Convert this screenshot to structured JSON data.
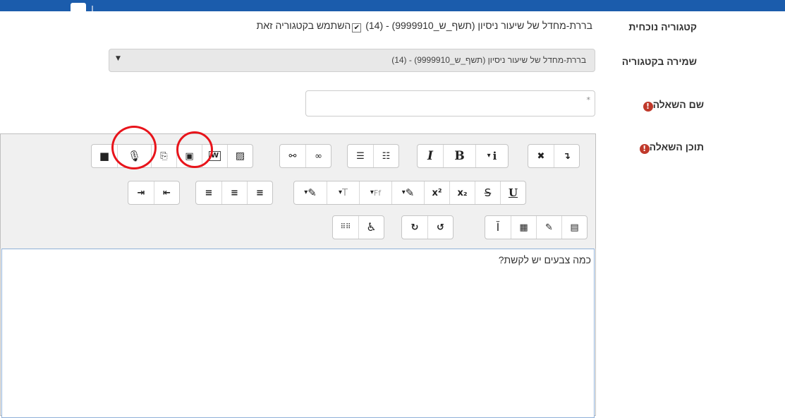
{
  "colors": {
    "topbar": "#1b5cac",
    "required": "#c0392b",
    "annotation": "#e8141b"
  },
  "form": {
    "current_category": {
      "label": "קטגוריה נוכחית",
      "value": "בררת-מחדל של שיעור ניסיון (תשף_ש_9999910) - (14)",
      "checkbox_label": "השתמש בקטגוריה זאת",
      "checked": true
    },
    "save_in_category": {
      "label": "שמירה בקטגוריה",
      "selected": "בררת-מחדל של שיעור ניסיון (תשף_ש_9999910) - (14)"
    },
    "question_name": {
      "label": "שם השאלה",
      "value": "",
      "required_marker": "*"
    },
    "question_text": {
      "label": "תוכן השאלה",
      "content": "כמה צבעים יש לקשת?"
    }
  },
  "toolbar": {
    "row1": [
      [
        "fullscreen-icon",
        "collapse-icon"
      ],
      [
        "text-style-dropdown",
        "bold",
        "italic"
      ],
      [
        "unordered-list-icon",
        "ordered-list-icon"
      ],
      [
        "link-icon",
        "unlink-icon"
      ],
      [
        "image-icon",
        "word-import-icon",
        "video-record-icon",
        "paste-icon",
        "audio-record-icon",
        "video-icon"
      ]
    ],
    "row2": [
      [
        "underline",
        "strikethrough",
        "subscript",
        "superscript",
        "background-color-dropdown"
      ],
      [
        "font-family-dropdown",
        "font-size-dropdown",
        "text-color-dropdown"
      ],
      [
        "align-left-icon",
        "align-center-icon",
        "align-right-icon"
      ],
      [
        "outdent-icon",
        "indent-icon"
      ]
    ],
    "row3": [
      [
        "calculator-icon",
        "edit-icon",
        "table-icon",
        "cursor-icon"
      ],
      [
        "undo-icon",
        "redo-icon"
      ],
      [
        "accessibility-icon",
        "braille-icon"
      ]
    ]
  }
}
